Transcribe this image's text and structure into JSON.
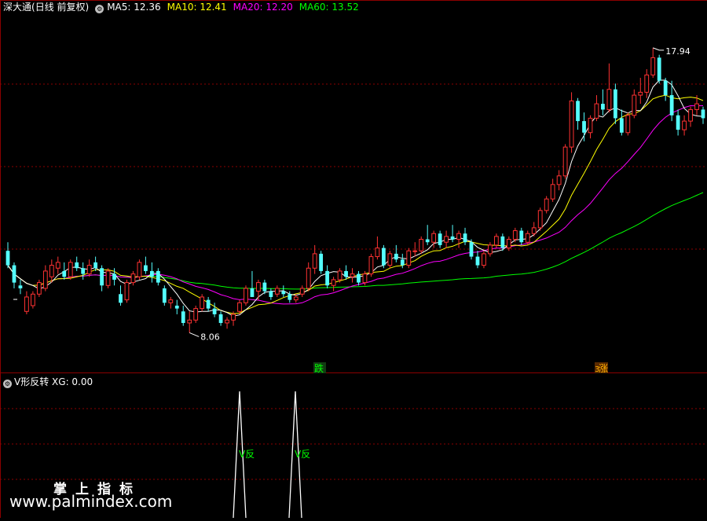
{
  "header": {
    "stock_name": "深大通",
    "period": "(日线 前复权)",
    "circle_icon": "gear-icon",
    "ma5": {
      "label": "MA5: 12.36",
      "color": "#ffffff"
    },
    "ma10": {
      "label": "MA10: 12.41",
      "color": "#ffff00"
    },
    "ma20": {
      "label": "MA20: 12.20",
      "color": "#ff00ff"
    },
    "ma60": {
      "label": "MA60: 13.52",
      "color": "#00ff00"
    }
  },
  "indicator": {
    "name": "V形反转",
    "value_label": "XG: 0.00",
    "signal_text": "V反",
    "signal_color": "#00ff00"
  },
  "markers": {
    "low_price": "8.06",
    "high_price": "17.94",
    "event1": "跌",
    "event2": "涨",
    "event2_prefix": "3"
  },
  "watermark": {
    "line1": "掌上指标",
    "line2": "www.palmindex.com"
  },
  "colors": {
    "up": "#ff3232",
    "down": "#54ffff",
    "grid": "#8b0000",
    "ma5": "#ffffff",
    "ma10": "#ffff00",
    "ma20": "#ff00ff",
    "ma60": "#00ff00"
  },
  "chart_data": {
    "type": "candlestick",
    "ylim": [
      7.2,
      19.0
    ],
    "ohlc": [
      [
        10.9,
        11.2,
        10.3,
        10.4
      ],
      [
        10.4,
        10.5,
        9.6,
        9.8
      ],
      [
        9.7,
        9.9,
        9.4,
        9.6
      ],
      [
        8.8,
        9.5,
        8.7,
        9.3
      ],
      [
        9.0,
        9.5,
        8.9,
        9.4
      ],
      [
        9.4,
        9.9,
        9.3,
        9.8
      ],
      [
        9.6,
        10.4,
        9.5,
        10.2
      ],
      [
        10.0,
        10.6,
        9.8,
        10.4
      ],
      [
        10.3,
        10.7,
        10.1,
        10.5
      ],
      [
        10.2,
        10.5,
        9.9,
        10.0
      ],
      [
        10.0,
        10.6,
        9.9,
        10.5
      ],
      [
        10.5,
        10.7,
        10.2,
        10.3
      ],
      [
        10.3,
        10.5,
        9.9,
        10.1
      ],
      [
        10.1,
        10.6,
        10.0,
        10.4
      ],
      [
        10.5,
        10.7,
        10.2,
        10.3
      ],
      [
        10.3,
        10.4,
        9.5,
        9.7
      ],
      [
        9.7,
        10.3,
        9.6,
        10.2
      ],
      [
        10.1,
        10.3,
        9.7,
        9.9
      ],
      [
        9.4,
        9.7,
        9.0,
        9.1
      ],
      [
        9.2,
        9.9,
        9.1,
        9.8
      ],
      [
        9.8,
        10.2,
        9.7,
        10.1
      ],
      [
        10.0,
        10.6,
        9.9,
        10.5
      ],
      [
        10.4,
        10.7,
        10.1,
        10.2
      ],
      [
        10.2,
        10.5,
        9.8,
        10.0
      ],
      [
        10.2,
        10.3,
        9.7,
        9.8
      ],
      [
        9.6,
        9.7,
        9.0,
        9.1
      ],
      [
        9.1,
        9.3,
        8.9,
        9.2
      ],
      [
        9.0,
        9.2,
        8.7,
        8.9
      ],
      [
        8.8,
        9.0,
        8.3,
        8.4
      ],
      [
        8.4,
        8.8,
        8.06,
        8.5
      ],
      [
        8.5,
        9.0,
        8.4,
        8.9
      ],
      [
        8.9,
        9.4,
        8.8,
        9.3
      ],
      [
        9.2,
        9.3,
        8.8,
        8.9
      ],
      [
        8.9,
        9.1,
        8.6,
        8.7
      ],
      [
        8.7,
        8.8,
        8.3,
        8.4
      ],
      [
        8.4,
        8.6,
        8.2,
        8.5
      ],
      [
        8.5,
        8.8,
        8.3,
        8.7
      ],
      [
        8.8,
        9.2,
        8.7,
        9.1
      ],
      [
        9.1,
        9.7,
        9.0,
        9.6
      ],
      [
        9.6,
        10.2,
        9.5,
        9.3
      ],
      [
        9.5,
        9.9,
        9.2,
        9.8
      ],
      [
        9.8,
        9.9,
        9.4,
        9.5
      ],
      [
        9.5,
        9.6,
        9.2,
        9.3
      ],
      [
        9.4,
        9.7,
        9.3,
        9.6
      ],
      [
        9.5,
        9.7,
        9.3,
        9.4
      ],
      [
        9.4,
        9.5,
        9.1,
        9.2
      ],
      [
        9.2,
        9.4,
        9.1,
        9.3
      ],
      [
        9.4,
        9.7,
        9.3,
        9.6
      ],
      [
        9.6,
        10.5,
        9.5,
        10.3
      ],
      [
        10.3,
        11.1,
        10.1,
        10.8
      ],
      [
        10.8,
        10.9,
        10.1,
        10.2
      ],
      [
        10.2,
        10.4,
        9.6,
        9.7
      ],
      [
        9.7,
        10.0,
        9.5,
        9.9
      ],
      [
        9.9,
        10.3,
        9.8,
        10.2
      ],
      [
        10.2,
        10.4,
        9.9,
        10.0
      ],
      [
        10.0,
        10.3,
        9.8,
        10.1
      ],
      [
        10.1,
        10.2,
        9.7,
        9.8
      ],
      [
        9.8,
        10.2,
        9.7,
        10.1
      ],
      [
        10.1,
        10.8,
        10.0,
        10.7
      ],
      [
        10.7,
        11.4,
        10.6,
        11.0
      ],
      [
        11.0,
        11.1,
        10.3,
        10.4
      ],
      [
        10.4,
        10.9,
        10.3,
        10.8
      ],
      [
        10.8,
        11.1,
        10.5,
        10.6
      ],
      [
        10.6,
        10.8,
        10.3,
        10.4
      ],
      [
        10.4,
        11.0,
        10.3,
        10.9
      ],
      [
        10.9,
        11.2,
        10.7,
        10.9
      ],
      [
        10.9,
        11.4,
        10.8,
        11.3
      ],
      [
        11.3,
        11.8,
        11.1,
        11.2
      ],
      [
        11.2,
        11.6,
        11.0,
        11.5
      ],
      [
        11.5,
        11.6,
        11.0,
        11.1
      ],
      [
        11.2,
        11.6,
        11.0,
        11.4
      ],
      [
        11.4,
        11.8,
        11.2,
        11.3
      ],
      [
        11.3,
        11.6,
        11.0,
        11.5
      ],
      [
        11.5,
        11.7,
        11.1,
        11.2
      ],
      [
        11.2,
        11.3,
        10.6,
        10.7
      ],
      [
        10.7,
        10.9,
        10.3,
        10.4
      ],
      [
        10.4,
        10.9,
        10.3,
        10.8
      ],
      [
        10.8,
        11.2,
        10.7,
        11.1
      ],
      [
        11.1,
        11.5,
        11.0,
        11.4
      ],
      [
        11.4,
        11.5,
        10.9,
        11.0
      ],
      [
        11.0,
        11.4,
        10.9,
        11.3
      ],
      [
        11.3,
        11.7,
        11.2,
        11.6
      ],
      [
        11.6,
        11.7,
        11.1,
        11.2
      ],
      [
        11.2,
        11.6,
        11.1,
        11.5
      ],
      [
        11.5,
        11.9,
        11.4,
        11.7
      ],
      [
        11.7,
        12.4,
        11.6,
        12.3
      ],
      [
        12.3,
        12.8,
        12.2,
        12.7
      ],
      [
        12.7,
        13.4,
        12.6,
        13.2
      ],
      [
        13.2,
        13.7,
        13.0,
        13.5
      ],
      [
        13.5,
        14.6,
        13.4,
        14.5
      ],
      [
        14.5,
        16.4,
        14.3,
        16.1
      ],
      [
        16.1,
        16.2,
        15.1,
        15.4
      ],
      [
        15.4,
        15.7,
        14.7,
        15.0
      ],
      [
        15.0,
        15.6,
        14.8,
        15.5
      ],
      [
        15.5,
        16.3,
        15.4,
        16.0
      ],
      [
        16.0,
        16.5,
        15.6,
        15.8
      ],
      [
        15.8,
        17.4,
        15.7,
        16.5
      ],
      [
        16.5,
        16.7,
        15.3,
        15.5
      ],
      [
        15.5,
        15.8,
        14.9,
        15.0
      ],
      [
        15.0,
        15.7,
        14.9,
        15.6
      ],
      [
        15.6,
        16.5,
        15.5,
        16.3
      ],
      [
        16.3,
        16.9,
        16.0,
        16.4
      ],
      [
        16.4,
        17.2,
        16.2,
        17.0
      ],
      [
        17.0,
        17.94,
        16.9,
        17.6
      ],
      [
        17.6,
        17.7,
        16.7,
        16.8
      ],
      [
        16.8,
        16.9,
        16.1,
        16.3
      ],
      [
        16.3,
        16.8,
        15.4,
        15.6
      ],
      [
        15.6,
        15.8,
        14.9,
        15.1
      ],
      [
        15.1,
        15.6,
        14.9,
        15.4
      ],
      [
        15.4,
        15.9,
        15.2,
        15.8
      ],
      [
        15.8,
        16.3,
        15.6,
        16.0
      ],
      [
        15.8,
        15.9,
        15.3,
        15.5
      ]
    ]
  }
}
